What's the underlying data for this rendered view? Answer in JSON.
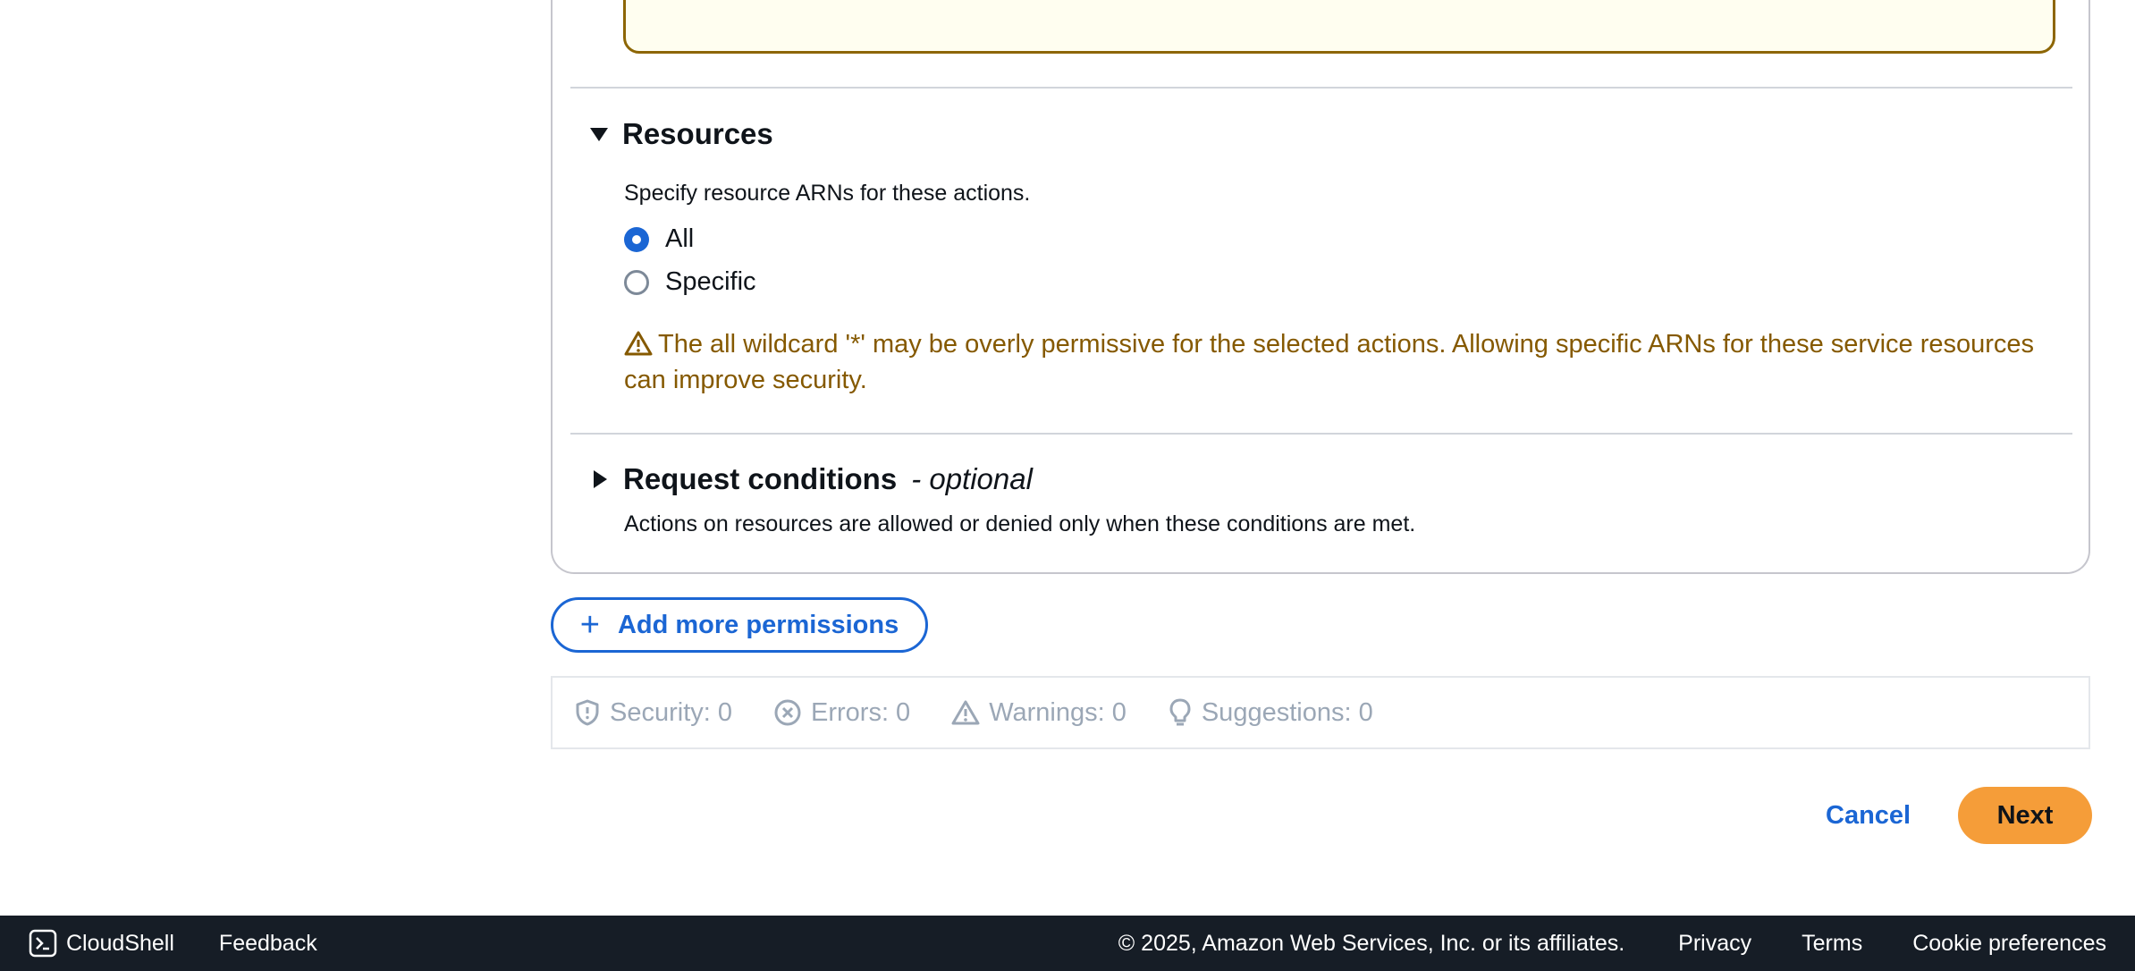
{
  "resources": {
    "title": "Resources",
    "description": "Specify resource ARNs for these actions.",
    "options": [
      {
        "label": "All",
        "selected": true
      },
      {
        "label": "Specific",
        "selected": false
      }
    ],
    "warning": "The all wildcard '*' may be overly permissive for the selected actions. Allowing specific ARNs for these service resources can improve security."
  },
  "request_conditions": {
    "title": "Request conditions",
    "optional": "- optional",
    "description": "Actions on resources are allowed or denied only when these conditions are met."
  },
  "add_permissions": {
    "label": "Add more permissions",
    "icon": "plus-icon"
  },
  "status": {
    "security": "Security: 0",
    "errors": "Errors: 0",
    "warnings": "Warnings: 0",
    "suggestions": "Suggestions: 0"
  },
  "actions": {
    "cancel": "Cancel",
    "next": "Next"
  },
  "footer": {
    "cloudshell": "CloudShell",
    "feedback": "Feedback",
    "copyright": "© 2025, Amazon Web Services, Inc. or its affiliates.",
    "privacy": "Privacy",
    "terms": "Terms",
    "cookies": "Cookie preferences"
  },
  "colors": {
    "primary": "#1b66d4",
    "warning_text": "#855900",
    "next_button": "#f59d39",
    "footer_bg": "#161d26"
  }
}
